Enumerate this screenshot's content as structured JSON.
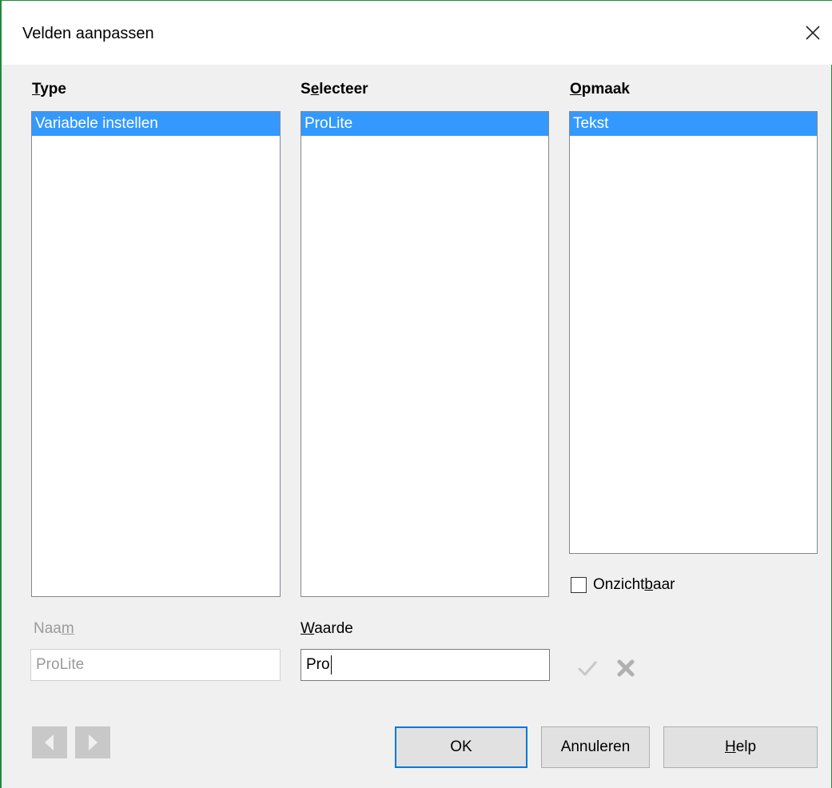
{
  "dialog": {
    "title": "Velden aanpassen"
  },
  "type": {
    "label_prefix": "",
    "label_u": "T",
    "label_rest": "ype",
    "items": [
      "Variabele instellen"
    ]
  },
  "select": {
    "label_prefix": "S",
    "label_u": "e",
    "label_rest": "lecteer",
    "items": [
      "ProLite"
    ]
  },
  "format": {
    "label_prefix": "",
    "label_u": "O",
    "label_rest": "pmaak",
    "items": [
      "Tekst"
    ]
  },
  "invisible": {
    "label_prefix": "Onzicht",
    "label_u": "b",
    "label_rest": "aar",
    "checked": false
  },
  "name": {
    "label_prefix": "Naa",
    "label_u": "m",
    "label_rest": "",
    "value": "ProLite"
  },
  "value": {
    "label_prefix": "",
    "label_u": "W",
    "label_rest": "aarde",
    "value": "Pro"
  },
  "buttons": {
    "ok": "OK",
    "cancel": "Annuleren",
    "help_u": "H",
    "help_rest": "elp"
  },
  "icons": {
    "close": "close-icon",
    "apply": "checkmark-icon",
    "delete": "delete-icon",
    "prev": "arrow-left-icon",
    "next": "arrow-right-icon"
  },
  "colors": {
    "selection": "#3399ff",
    "default_button_border": "#0078d7",
    "window_border": "#1e8a3e"
  }
}
